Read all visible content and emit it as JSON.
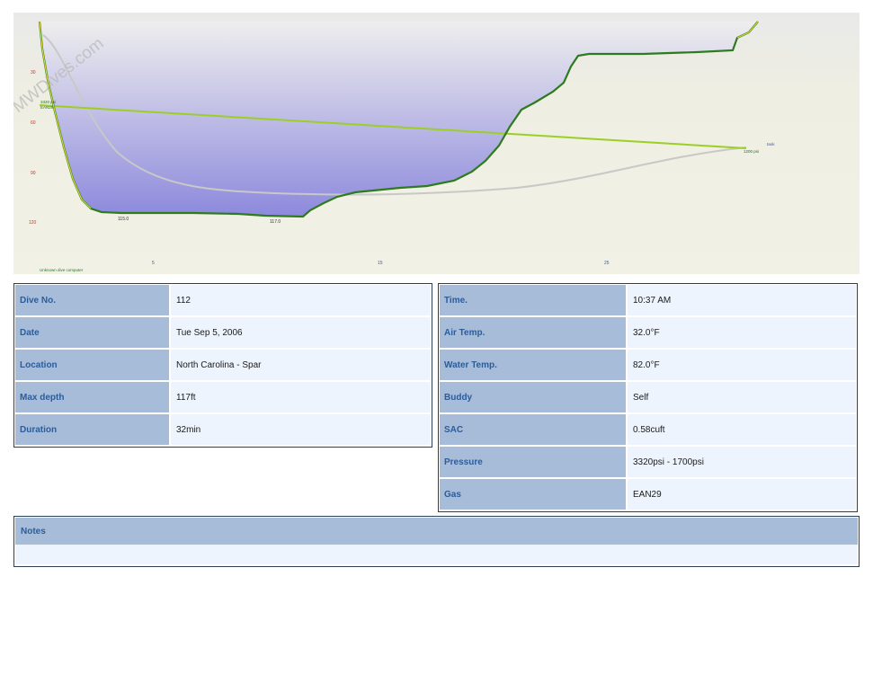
{
  "watermark": "MWDives.com",
  "profile": {
    "computer_label": "Unknown dive computer",
    "depth_ticks": [
      "30",
      "60",
      "90",
      "120"
    ],
    "time_ticks": [
      "5",
      "15",
      "25"
    ],
    "start_pressure": "3320 psi",
    "gas_label": "EAN29",
    "end_pressure": "1200 psi",
    "end_gas_label": "tank",
    "max_depth_labels": [
      "115.0",
      "117.0"
    ],
    "colors": {
      "background": "#f1f1e5",
      "water_top": "#eeeeee",
      "water_bottom": "#8d89dd",
      "depth_line": "#1f7a1f",
      "pressure_line": "#7dc21e",
      "ceiling_line": "#c8c8c8"
    }
  },
  "details_left": [
    {
      "label": "Dive No.",
      "value": "112"
    },
    {
      "label": "Date",
      "value": "Tue Sep 5, 2006"
    },
    {
      "label": "Location",
      "value": "North Carolina - Spar"
    },
    {
      "label": "Max depth",
      "value": "117ft"
    },
    {
      "label": "Duration",
      "value": "32min"
    }
  ],
  "details_right": [
    {
      "label": "Time.",
      "value": "10:37 AM"
    },
    {
      "label": "Air Temp.",
      "value": "32.0°F"
    },
    {
      "label": "Water Temp.",
      "value": "82.0°F"
    },
    {
      "label": "Buddy",
      "value": "Self"
    },
    {
      "label": "SAC",
      "value": "0.58cuft"
    },
    {
      "label": "Pressure",
      "value": "3320psi - 1700psi"
    },
    {
      "label": "Gas",
      "value": "EAN29"
    }
  ],
  "notes": {
    "label": "Notes",
    "text": ""
  }
}
